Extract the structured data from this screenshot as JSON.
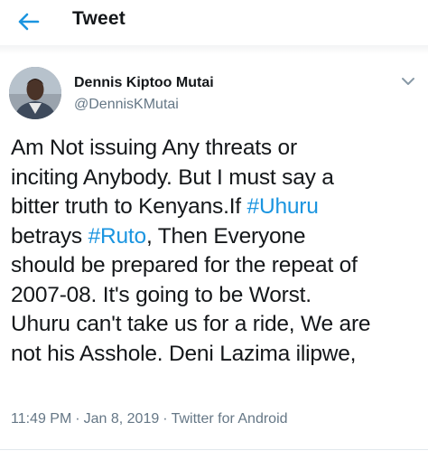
{
  "header": {
    "title": "Tweet",
    "back_icon": "arrow-left-icon",
    "accent_color": "#1b95e0"
  },
  "author": {
    "name": "Dennis Kiptoo Mutai",
    "handle": "@DennisKMutai",
    "avatar_icon": "user-photo"
  },
  "menu_icon": "chevron-down-icon",
  "tweet": {
    "lines": [
      [
        {
          "t": "Am Not issuing Any threats or"
        }
      ],
      [
        {
          "t": "inciting Anybody. But I must say a"
        }
      ],
      [
        {
          "t": "bitter truth to Kenyans.If "
        },
        {
          "t": "#Uhuru",
          "tag": true
        }
      ],
      [
        {
          "t": "betrays "
        },
        {
          "t": "#Ruto",
          "tag": true
        },
        {
          "t": ", Then Everyone"
        }
      ],
      [
        {
          "t": "should be prepared for the repeat of"
        }
      ],
      [
        {
          "t": "2007-08. It's going to be Worst."
        }
      ],
      [
        {
          "t": "Uhuru can't take us for a ride, We are"
        }
      ],
      [
        {
          "t": "not his Asshole. Deni Lazima ilipwe,"
        }
      ]
    ]
  },
  "meta": {
    "time": "11:49 PM",
    "separator": "·",
    "date": "Jan 8, 2019",
    "source": "Twitter for Android"
  }
}
